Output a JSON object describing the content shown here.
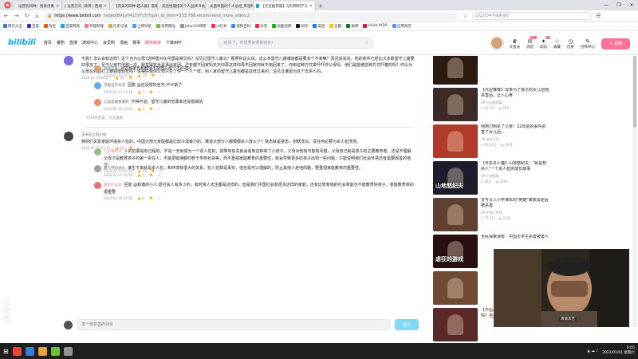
{
  "browser": {
    "tabs": [
      {
        "label": "运营的四种：搜索优惠"
      },
      {
        "label": "运营方向 -微博 | 西湖"
      },
      {
        "label": "【完美的四种-超人群】家能的"
      },
      {
        "label": "前后性理提的个人品牌 B站"
      },
      {
        "label": "光面有面的个人总结_哔哩哔哩"
      },
      {
        "label": "【元宝推荐篇】与利用明学习",
        "active": true
      }
    ],
    "new_tab": "+",
    "window_controls": [
      "—",
      "❐",
      "✕"
    ],
    "url_host": "https://www.bilibili.com",
    "url_path": "/video/BV1vT411Y7cT/?spm_id_from=333.788.recommend_more_video.2",
    "omni_search": "2022年中学排名排行",
    "bookmarks": [
      "网页大全",
      "百度",
      "淘宝",
      "百度网盘",
      "哔哩哔哩",
      "历史记录",
      "上网导航",
      "常用网址",
      "jake334博客",
      "小红书",
      "搜狗百科",
      "抖音",
      "优酷视频",
      "知乎",
      "美团",
      "豆瓣",
      "微博",
      "ULike WDA",
      "应用商店"
    ]
  },
  "site": {
    "logo": "bilibili",
    "nav": [
      "首页",
      "番剧",
      "直播",
      "游戏中心",
      "会员购",
      "漫画",
      "赛事",
      "跨年晚会",
      "下载APP"
    ],
    "search_placeholder": "给我了，你想要的我都给你!",
    "header_icons": [
      {
        "label": "大会员",
        "glyph": "♛",
        "badge": ""
      },
      {
        "label": "消息",
        "glyph": "✉",
        "badge": "99+"
      },
      {
        "label": "动态",
        "glyph": "✦",
        "badge": "43"
      },
      {
        "label": "收藏",
        "glyph": "☆",
        "badge": ""
      },
      {
        "label": "历史",
        "glyph": "◷",
        "badge": ""
      },
      {
        "label": "创作中心",
        "glyph": "✎",
        "badge": ""
      }
    ],
    "upload_label": "投稿"
  },
  "comments": [
    {
      "user": "",
      "text": "不高？怎么会有这样？这个当为父母?这种害对在中国是常见吗？没见过留守儿童么？那照你这么说，这么多留守儿童难道都是要多个不幸嘛？而且说实话，他的条件已经比大多数留守儿童要好很多了。至于父亲打他那一次，我觉得完全是事出有因。过年都不回家吗天天你再这样你再不回家你就不用回来了，你用这种方式来吓吓你父母吗，他们是能被这种方式吓着的吗？你以为父母在外面打工赚钱很轻松吗？说得好像你父母只生了你一个人一样，别人家的留守儿童也都是这样过来的，没见过谁因为这个去杀人的。",
      "date": "2020-02-15 18:27",
      "likes": "10",
      "more": "共34条回复，点击查看"
    },
    {
      "user": "天天向上的小仙",
      "vip": false,
      "text": "特别们关爱家庭环境杀人犯的，中国大部分家庭都是比较冷漠暴力的，难道大部分人都要都杀人放火了？变态就是变态，别瞎洗白。没任何必要为杀人犯洗地。",
      "date": "2020-02-15 13:37",
      "likes": "43",
      "more": ""
    }
  ],
  "replies_a": [
    {
      "user": "你就是谁",
      "text": "对这种家长和教师不能放心那个不必担心",
      "date": "2020-02-15 21:33",
      "likes": "13"
    },
    {
      "user": "可能当年有志",
      "text": "回复 @还没想好名字:卢卡斯了",
      "date": "2020-02-15 19:29",
      "likes": "2"
    },
    {
      "user": "心灵是最重要的",
      "text": "不得不说，留守儿童的犯罪率还是很高的",
      "date": "2020-02-16 19:36",
      "likes": "2"
    }
  ],
  "replies_b": [
    {
      "user": "八卦两杆子",
      "vip": true,
      "text": "人的犯罪是有过程的，不是一天就成为一个杀人犯的，如果有些关就会看到这种来了小孩子，父母对他有可能有问题，父母自己就是孩子的主要教育者，还是不理解父母才是教育孩子的第一责任人，不能把错误都归咎于学校社会等，而不重视家庭教育的重要性，就会导致更多的孩子出现一些问题，只能说明我们社会环境还有需要改善的地方。",
      "date": "2020-02-15 16:34",
      "likes": "91"
    },
    {
      "user": "路人甲的评论",
      "vip": false,
      "text": "谁生下来就是杀人犯，和环境有很大的关系，犯人犯罪是事实，但也是可以理解的，防止其他人走他的路，要重视家庭教育的重要性。",
      "date": "2020-02-15 16:55",
      "likes": "2"
    },
    {
      "user": "想说什么说",
      "vip": true,
      "text": "回复 @和谐的小人:原社会人有多少的，有时候人天生都是这样的，但是我们中国社会有很多这样的家庭，还有比较有钱的社会家庭也不能教育好孩子，家庭教育真的很重要",
      "date": "2020-02-16 10:36",
      "likes": "8"
    }
  ],
  "reply_input_placeholder": "发一条友善的评论",
  "send_label": "发布",
  "recommendations": [
    {
      "title": "",
      "uploader": "",
      "views": "",
      "comments": "",
      "duration": "",
      "caption": ""
    },
    {
      "title": "【元宝推荐】母亲为了孩子的女儿把他杀害后，让人心疼",
      "uploader": "元宝推荐篇",
      "views": "20.1万",
      "comments": "254",
      "duration": "",
      "caption": ""
    },
    {
      "title": "他用刀刺杀了父亲！22年前的事件杀害了女儿后...",
      "uploader": "苏州大学",
      "views": "452.6万",
      "comments": "7941",
      "duration": "",
      "caption": ""
    },
    {
      "title": "【日本杀人魔】山地悠纪夫：\"就是想杀人\"一个杀人犯的成长故事",
      "uploader": "小明知道",
      "views": "90万",
      "comments": "2460",
      "duration": "",
      "caption": "山地悠纪夫"
    },
    {
      "title": "冒号写入小学课本的\"英雄\"离家出走后被杀害",
      "uploader": "中国人在线",
      "views": "77.5万",
      "comments": "2132",
      "duration": "",
      "caption": ""
    },
    {
      "title": "全民探索凄惨：中国大学生杀害被害人",
      "uploader": "",
      "views": "",
      "comments": "",
      "duration": "",
      "caption": "虐狂的游戏"
    },
    {
      "title": "",
      "uploader": "",
      "views": "",
      "comments": "",
      "duration": "",
      "caption": ""
    },
    {
      "title": "【午后说香案】你在现实中见过变态计吗？自身曾经奇怪",
      "uploader": "",
      "views": "",
      "comments": "",
      "duration": "",
      "caption": ""
    }
  ],
  "pip_caption": "真情诉苦",
  "taskbar": {
    "time": "0:05",
    "date": "2022/01/01 星期六"
  }
}
